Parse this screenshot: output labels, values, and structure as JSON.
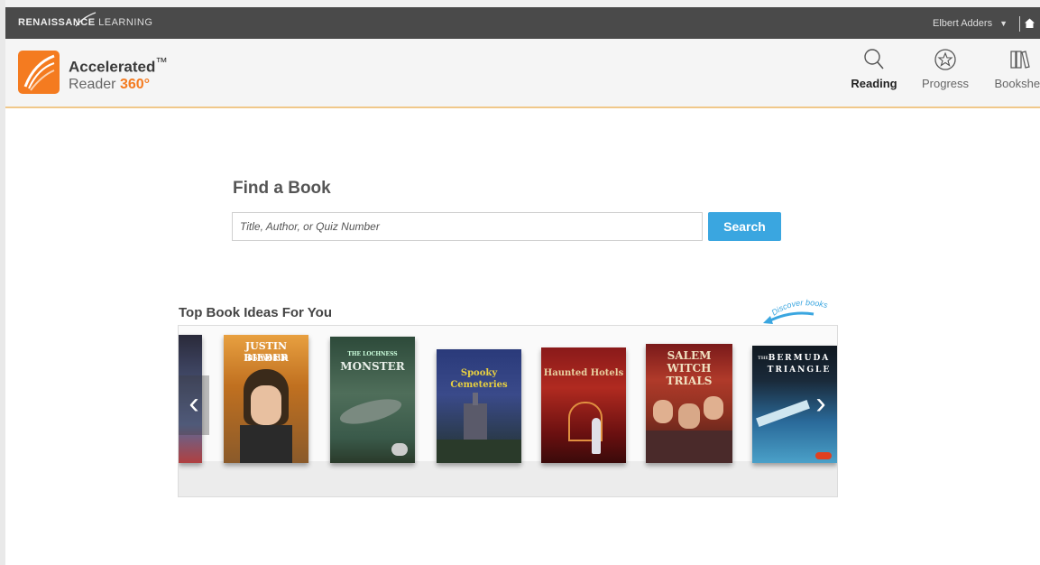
{
  "topbar": {
    "brand_bold": "RENAISSANCE",
    "brand_light": "LEARNING",
    "user_name": "Elbert Adders",
    "caret": "▼"
  },
  "app": {
    "logo_line1": "Accelerated",
    "logo_tm": "™",
    "logo_line2": "Reader",
    "logo_360": "360°"
  },
  "nav": {
    "reading": "Reading",
    "progress": "Progress",
    "bookshelf": "Bookshelf"
  },
  "find": {
    "title": "Find a Book",
    "placeholder": "Title, Author, or Quiz Number",
    "button": "Search"
  },
  "ideas": {
    "title": "Top Book Ideas For You",
    "discover": "Discover books",
    "prev_arrow": "‹",
    "next_arrow": "›",
    "books": [
      {
        "title": "",
        "colors": [
          "#b04040",
          "#2a2a3a"
        ]
      },
      {
        "title": "JUSTIN BIEBER",
        "subtitle": "HIS WORLD",
        "colors": [
          "#d98a2a",
          "#7a4a1a"
        ]
      },
      {
        "title": "MONSTER",
        "subtitle": "THE LOCHNESS",
        "colors": [
          "#4f6e5a",
          "#2d4a3a"
        ]
      },
      {
        "title": "Spooky Cemeteries",
        "subtitle": "",
        "colors": [
          "#3a4a8a",
          "#1e2a4a"
        ]
      },
      {
        "title": "Haunted Hotels",
        "subtitle": "",
        "colors": [
          "#a02020",
          "#4a1010"
        ]
      },
      {
        "title": "SALEM WITCH TRIALS",
        "subtitle": "",
        "colors": [
          "#b03a2a",
          "#e0c0a0"
        ]
      },
      {
        "title": "BERMUDA TRIANGLE",
        "subtitle": "THE",
        "colors": [
          "#1a2a3a",
          "#4aa0c8"
        ]
      }
    ]
  }
}
